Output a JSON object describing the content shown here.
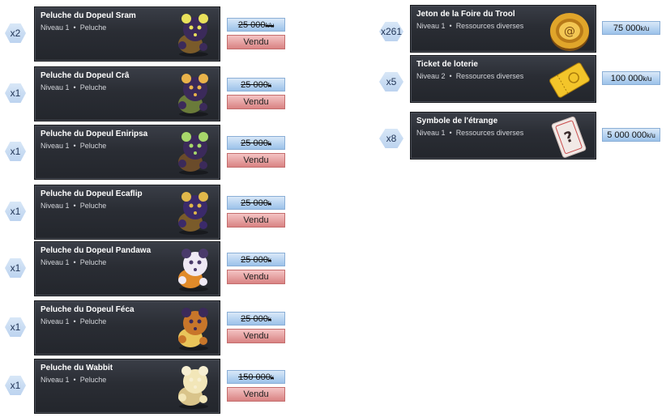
{
  "sold_label": "Vendu",
  "left_items": [
    {
      "qty": "x2",
      "title": "Peluche du Dopeul Sram",
      "level": "Niveau 1",
      "category": "Peluche",
      "price": "25 000",
      "unit": "k/u",
      "sold": true,
      "icon": "sram-plush-icon",
      "colors": [
        "#3b2a5a",
        "#e9e15b",
        "#7a5b2a"
      ]
    },
    {
      "qty": "x1",
      "title": "Peluche du Dopeul Crâ",
      "level": "Niveau 1",
      "category": "Peluche",
      "price": "25 000",
      "unit": "k",
      "sold": true,
      "icon": "cra-plush-icon",
      "colors": [
        "#3b2a5a",
        "#e9b34a",
        "#6a7b3a"
      ]
    },
    {
      "qty": "x1",
      "title": "Peluche du Dopeul Eniripsa",
      "level": "Niveau 1",
      "category": "Peluche",
      "price": "25 000",
      "unit": "k",
      "sold": true,
      "icon": "eniripsa-plush-icon",
      "colors": [
        "#3b2a5a",
        "#a7d86a",
        "#6a4b2a"
      ]
    },
    {
      "qty": "x1",
      "title": "Peluche du Dopeul Ecaflip",
      "level": "Niveau 1",
      "category": "Peluche",
      "price": "25 000",
      "unit": "k",
      "sold": true,
      "icon": "ecaflip-plush-icon",
      "colors": [
        "#3b2a6a",
        "#e0b84a",
        "#7a5b2a"
      ]
    },
    {
      "qty": "x1",
      "title": "Peluche du Dopeul Pandawa",
      "level": "Niveau 1",
      "category": "Peluche",
      "price": "25 000",
      "unit": "k",
      "sold": true,
      "icon": "pandawa-plush-icon",
      "colors": [
        "#efe9f4",
        "#4a3a6a",
        "#e08a2a"
      ]
    },
    {
      "qty": "x1",
      "title": "Peluche du Dopeul Féca",
      "level": "Niveau 1",
      "category": "Peluche",
      "price": "25 000",
      "unit": "k",
      "sold": true,
      "icon": "feca-plush-icon",
      "colors": [
        "#c8762a",
        "#3b2a5a",
        "#e9c55a"
      ]
    },
    {
      "qty": "x1",
      "title": "Peluche du Wabbit",
      "level": "Niveau 1",
      "category": "Peluche",
      "price": "150 000",
      "unit": "k",
      "sold": true,
      "icon": "wabbit-plush-icon",
      "colors": [
        "#f2e6b8",
        "#f7efd2",
        "#d9c48a"
      ]
    }
  ],
  "right_items": [
    {
      "qty": "x261",
      "title": "Jeton de la Foire du Trool",
      "level": "Niveau 1",
      "category": "Ressources diverses",
      "price": "75 000",
      "unit": "k/u",
      "icon": "trool-token-icon"
    },
    {
      "qty": "x5",
      "title": "Ticket de loterie",
      "level": "Niveau 2",
      "category": "Ressources diverses",
      "price": "100 000",
      "unit": "k/u",
      "icon": "lottery-ticket-icon"
    },
    {
      "qty": "x8",
      "title": "Symbole de l'étrange",
      "level": "Niveau 1",
      "category": "Ressources diverses",
      "price": "5 000 000",
      "unit": "k/u",
      "icon": "strange-symbol-card-icon"
    }
  ]
}
